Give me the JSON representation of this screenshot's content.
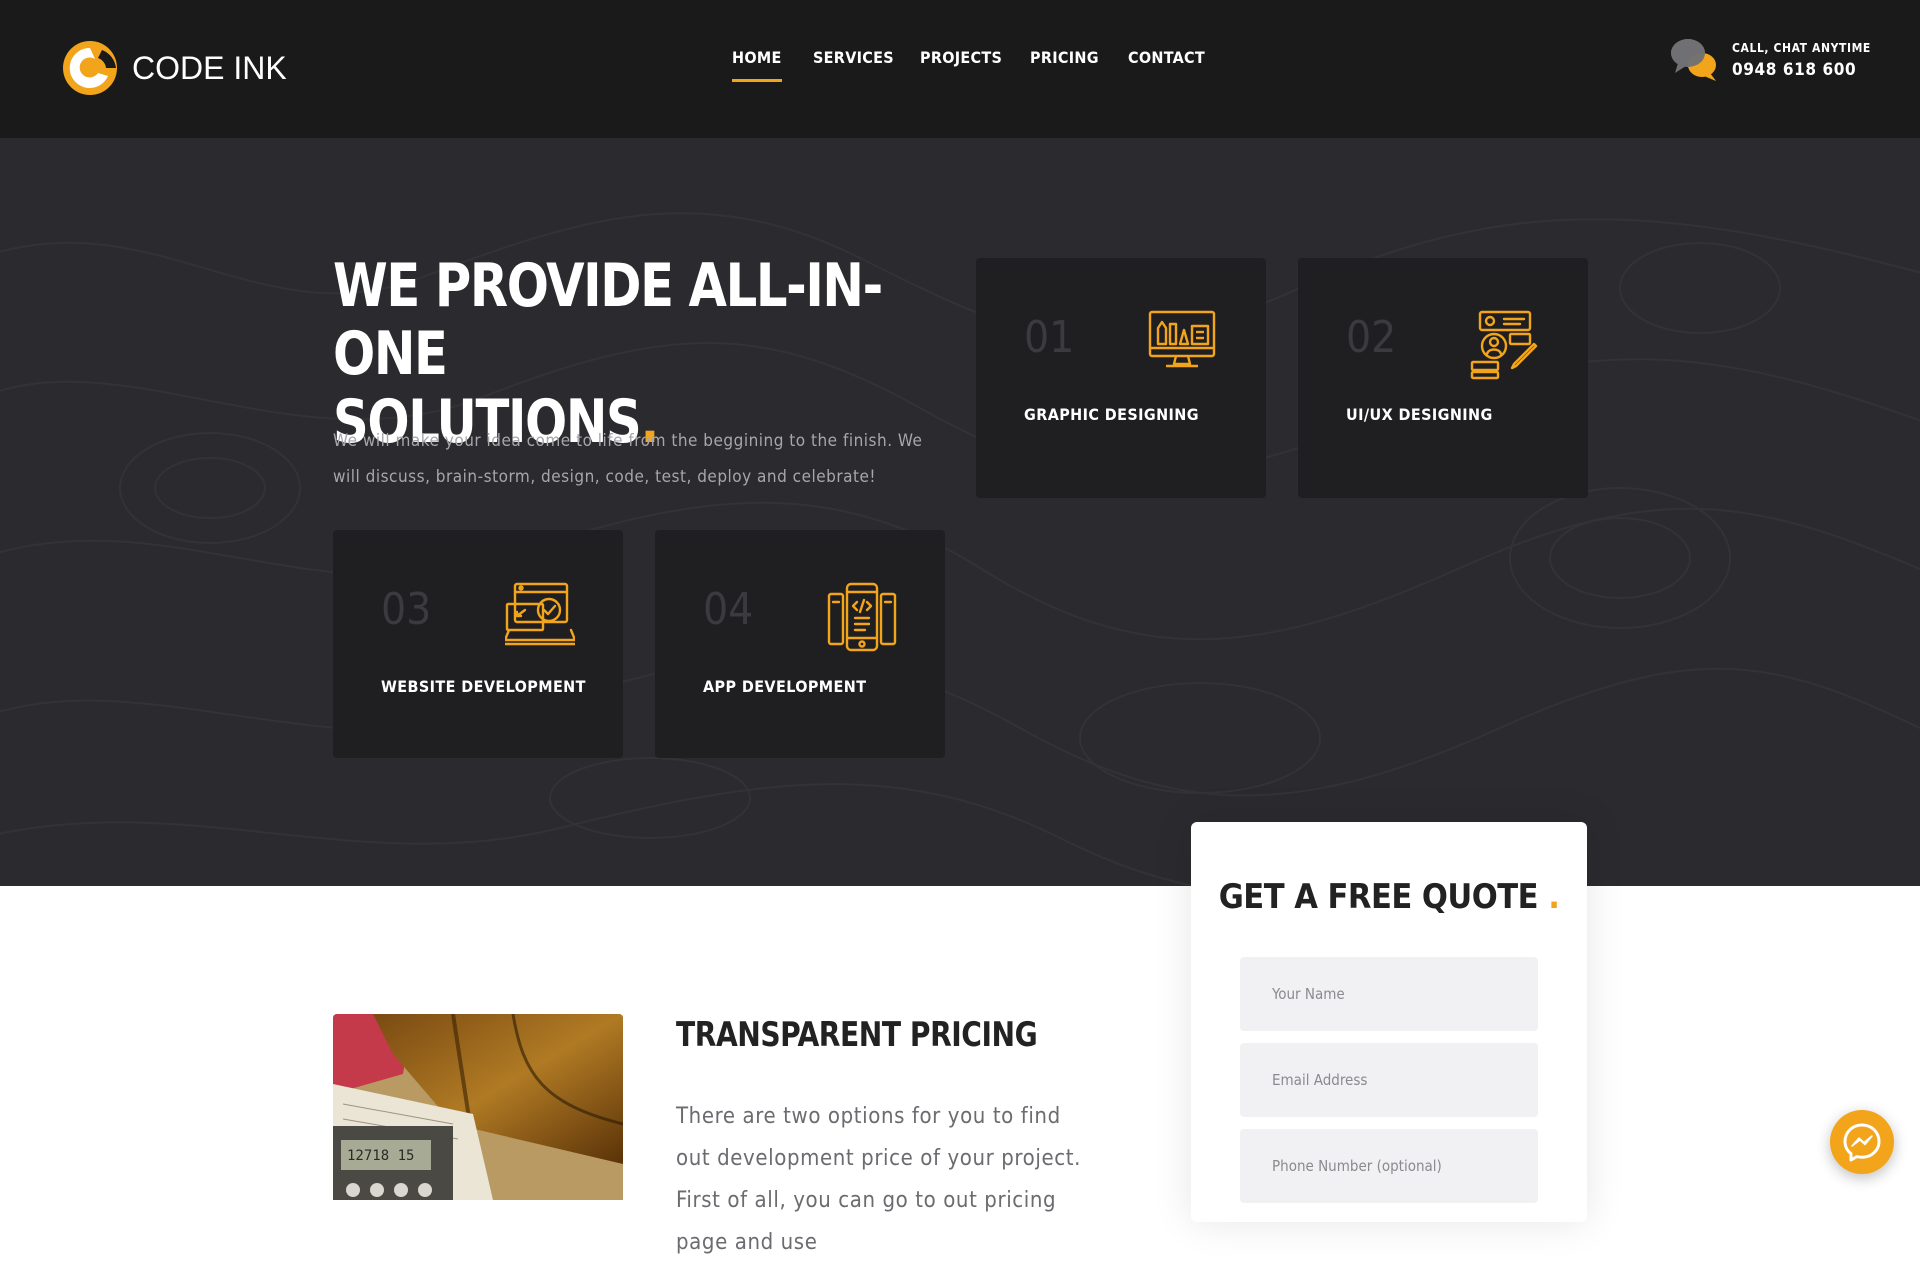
{
  "brand": {
    "name": "CODE INK",
    "accent": "#f2a51b"
  },
  "nav": {
    "items": [
      "HOME",
      "SERVICES",
      "PROJECTS",
      "PRICING",
      "CONTACT"
    ],
    "active": "HOME"
  },
  "contact": {
    "label": "CALL, CHAT ANYTIME",
    "phone": "0948 618 600",
    "icon": "chat-bubbles-icon"
  },
  "hero": {
    "title_line1": "WE PROVIDE ALL-IN-ONE",
    "title_line2": "SOLUTIONS",
    "title_dot": ".",
    "description": "We will make your idea come to life from the beggining to the finish. We will discuss, brain-storm, design, code, test, deploy and celebrate!"
  },
  "services": [
    {
      "num": "01",
      "title": "GRAPHIC DESIGNING",
      "icon": "monitor-design-icon"
    },
    {
      "num": "02",
      "title": "UI/UX DESIGNING",
      "icon": "ux-design-icon"
    },
    {
      "num": "03",
      "title": "WEBSITE DEVELOPMENT",
      "icon": "web-development-icon"
    },
    {
      "num": "04",
      "title": "APP DEVELOPMENT",
      "icon": "app-development-icon"
    }
  ],
  "quote": {
    "title": "GET A FREE QUOTE",
    "dot": ".",
    "name_placeholder": "Your Name",
    "email_placeholder": "Email Address",
    "phone_placeholder": "Phone Number (optional)"
  },
  "pricing": {
    "title": "TRANSPARENT PRICING",
    "text": "There are two options for you to find out development price of your project. First of all, you can go to out pricing page and use"
  },
  "chat_widget": {
    "icon": "messenger-icon"
  }
}
